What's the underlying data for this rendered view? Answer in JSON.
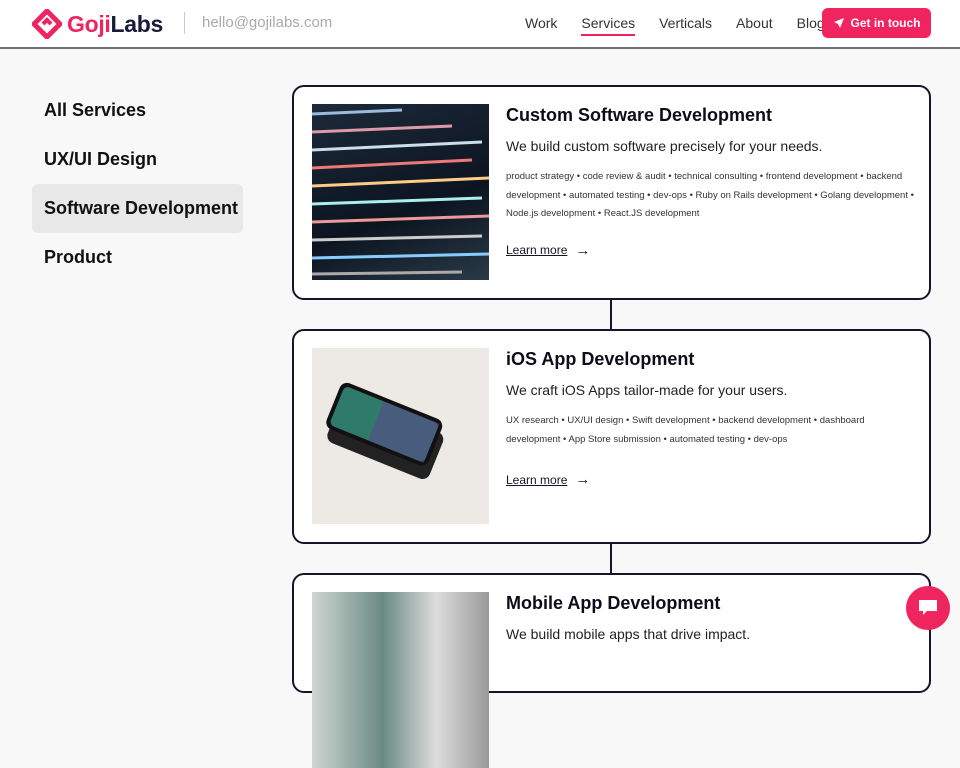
{
  "header": {
    "logo_goji": "Goji",
    "logo_labs": "Labs",
    "email": "hello@gojilabs.com",
    "nav": [
      "Work",
      "Services",
      "Verticals",
      "About",
      "Blog"
    ],
    "active_nav": "Services",
    "cta": "Get in touch"
  },
  "sidebar": {
    "items": [
      "All Services",
      "UX/UI Design",
      "Software Development",
      "Product"
    ],
    "active": "Software Development"
  },
  "services": [
    {
      "title": "Custom Software Development",
      "subtitle": "We build custom software precisely for your needs.",
      "tags": "product strategy • code review & audit • technical consulting • frontend development • backend development • automated testing • dev-ops • Ruby on Rails development • Golang development • Node.js development • React.JS development",
      "link": "Learn more"
    },
    {
      "title": "iOS App Development",
      "subtitle": "We craft iOS Apps tailor-made for your users.",
      "tags": "UX research • UX/UI design • Swift development • backend development • dashboard development • App Store submission • automated testing • dev-ops",
      "link": "Learn more"
    },
    {
      "title": "Mobile App Development",
      "subtitle": "We build mobile apps that drive impact."
    }
  ],
  "colors": {
    "accent": "#f0245f",
    "dark": "#15152a"
  }
}
